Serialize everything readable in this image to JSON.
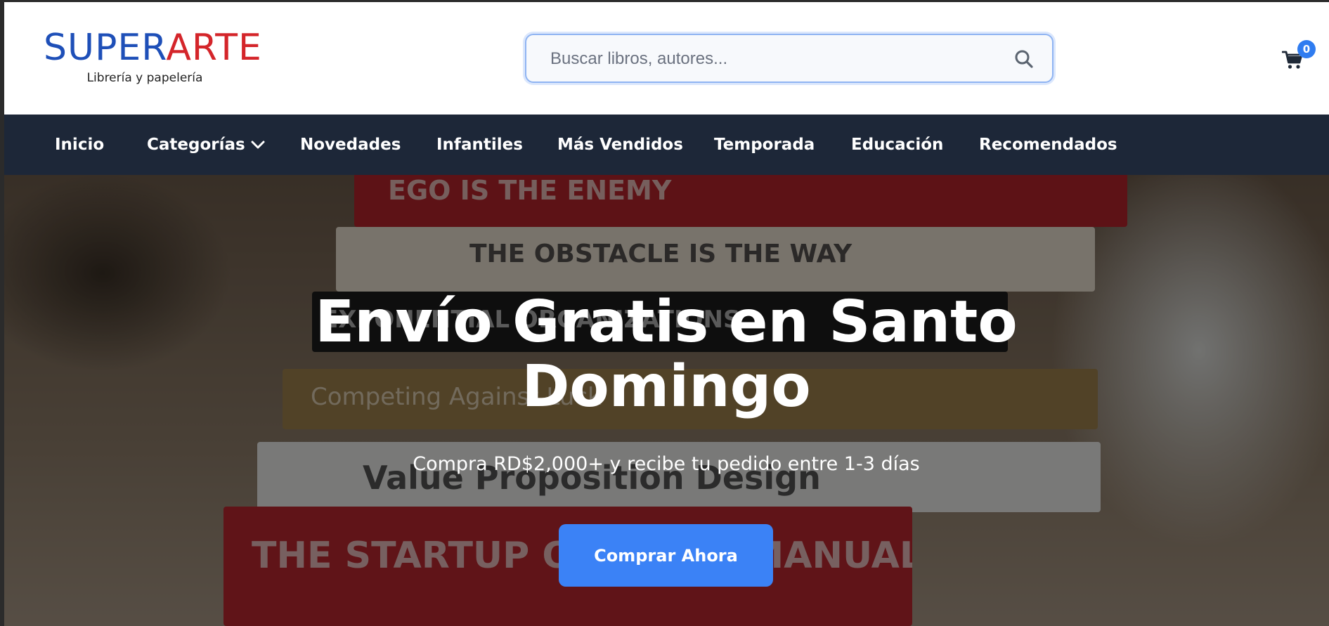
{
  "brand": {
    "name_part1": "SUPER",
    "name_part2": "ARTE",
    "tagline": "Librería y papelería",
    "colors": {
      "blue": "#1e4fb8",
      "red": "#d4252a"
    }
  },
  "search": {
    "placeholder": "Buscar libros, autores...",
    "value": "",
    "icon": "search-icon"
  },
  "cart": {
    "icon": "cart-icon",
    "count": "0"
  },
  "nav": {
    "items": [
      {
        "label": "Inicio"
      },
      {
        "label": "Categorías",
        "icon": "chevron-down-icon"
      },
      {
        "label": "Novedades"
      },
      {
        "label": "Infantiles"
      },
      {
        "label": "Más Vendidos"
      },
      {
        "label": "Temporada"
      },
      {
        "label": "Educación"
      },
      {
        "label": "Recomendados"
      }
    ],
    "background": "#1d2738"
  },
  "hero": {
    "title": "Envío Gratis en Santo Domingo",
    "subtitle": "Compra RD$2,000+ y recibe tu pedido entre 1-3 días",
    "cta_label": "Comprar Ahora",
    "cta_color": "#3b82f6",
    "image_books": [
      "EGO IS THE ENEMY",
      "THE OBSTACLE IS THE WAY",
      "EXPONENTIAL ORGANIZATIONS",
      "Competing Against Luck",
      "Value Proposition Design",
      "THE STARTUP OWNER'S MANUAL"
    ]
  }
}
